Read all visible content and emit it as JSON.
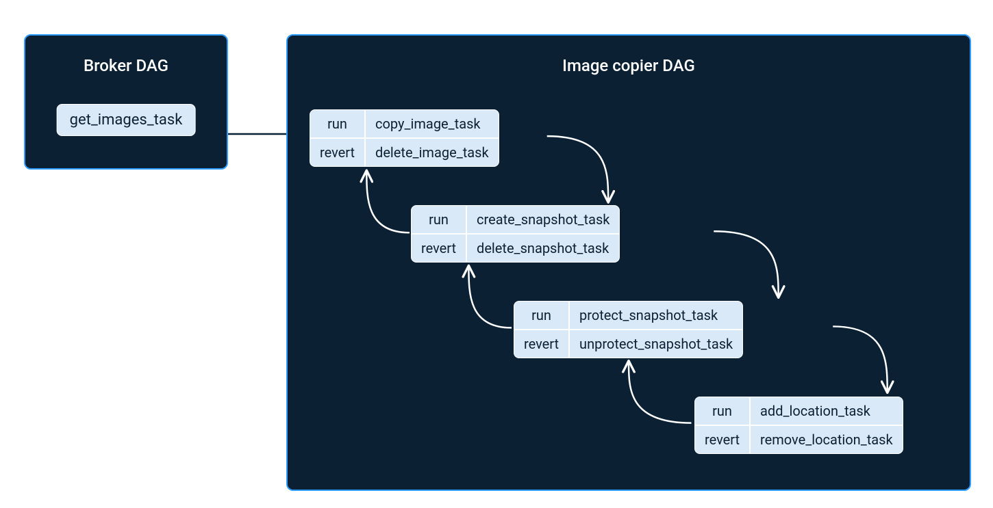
{
  "broker": {
    "title": "Broker DAG",
    "task": "get_images_task"
  },
  "copier": {
    "title": "Image copier DAG",
    "labels": {
      "run": "run",
      "revert": "revert"
    },
    "nodes": [
      {
        "run": "copy_image_task",
        "revert": "delete_image_task"
      },
      {
        "run": "create_snapshot_task",
        "revert": "delete_snapshot_task"
      },
      {
        "run": "protect_snapshot_task",
        "revert": "unprotect_snapshot_task"
      },
      {
        "run": "add_location_task",
        "revert": "remove_location_task"
      }
    ]
  },
  "colors": {
    "panel_bg": "#0b2033",
    "panel_border": "#2f9cff",
    "node_bg": "#d9e9f7",
    "arrow": "#ffffff"
  }
}
